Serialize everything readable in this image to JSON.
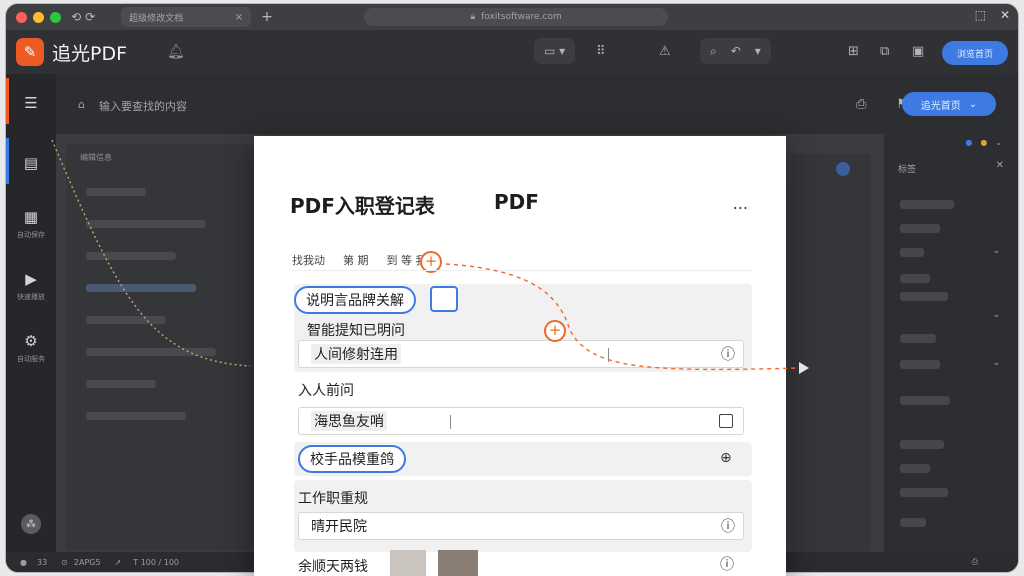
{
  "browser": {
    "tab_title": "超级修改文档",
    "address": "foxitsoftware.com"
  },
  "app": {
    "name": "追光PDF",
    "header_button": "浏览首页",
    "colors": {
      "brand": "#ee5a23",
      "accent": "#3d7be3",
      "annotation": "#ee6a2a"
    }
  },
  "toolbar": {
    "breadcrumb": "输入要查找的内容",
    "action_button": "追光首页"
  },
  "sidebar": {
    "items": [
      {
        "label": ""
      },
      {
        "label": ""
      },
      {
        "label": "自动保存"
      },
      {
        "label": "快速播放"
      },
      {
        "label": "自动服务"
      }
    ]
  },
  "workspace": {
    "panel_title": "编辑信息"
  },
  "right_panel": {
    "title": "标签"
  },
  "status": {
    "left": "33",
    "mid": "2APG5",
    "right": "T 100 / 100"
  },
  "card": {
    "title": "PDF入职登记表",
    "title_right": "PDF",
    "more": "...",
    "tabs": [
      "找我动",
      "第 期",
      "到 等 我"
    ],
    "rows": {
      "pill_1": "说明言品牌关解",
      "field_plain": "智能提知已明问",
      "field_1": "人间修射连用",
      "label_1": "入人前问",
      "field_2": "海思鱼友哨",
      "pill_2": "校手品模重鸽",
      "label_2": "工作职重规",
      "field_3": "晴开民院",
      "label_3": "余顺天两钱"
    }
  }
}
